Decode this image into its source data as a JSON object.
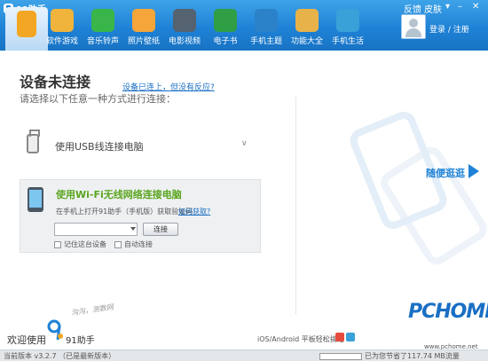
{
  "app": {
    "name": "91助手"
  },
  "window_controls": {
    "feedback": "反馈",
    "skin": "皮肤"
  },
  "nav": {
    "items": [
      {
        "label": "",
        "color": "#f3a623"
      },
      {
        "label": "软件游戏",
        "color": "#f0b43c"
      },
      {
        "label": "音乐铃声",
        "color": "#39b54a"
      },
      {
        "label": "照片壁纸",
        "color": "#f5a53a"
      },
      {
        "label": "电影视频",
        "color": "#556270"
      },
      {
        "label": "电子书",
        "color": "#2f9e44"
      },
      {
        "label": "手机主题",
        "color": "#2b82c9"
      },
      {
        "label": "功能大全",
        "color": "#e8b24a"
      },
      {
        "label": "手机生活",
        "color": "#3aa0d8"
      }
    ]
  },
  "user": {
    "login_label": "登录 / 注册"
  },
  "main": {
    "title": "设备未连接",
    "help_link": "设备已连上，但没有反应?",
    "subtitle": "请选择以下任意一种方式进行连接：",
    "usb": {
      "label": "使用USB线连接电脑",
      "chevron": "»"
    },
    "wifi": {
      "title": "使用Wi-Fi无线网络连接电脑",
      "hint": "在手机上打开91助手（手机版）获取验证码",
      "how_link": "如何获取?",
      "code_value": "",
      "connect_button": "连接",
      "remember_label": "记住这台设备",
      "auto_label": "自动连接"
    },
    "random_link": "随便逛逛"
  },
  "footer": {
    "welcome": "欢迎使用",
    "brand": "91助手",
    "slogan": "沟沟，测数网",
    "platform_text": "iOS/Android 平板轻松搞定"
  },
  "watermark": {
    "logo": "PCHOME",
    "url": "www.pchome.net"
  },
  "status": {
    "version": "当前版本 v3.2.7 （已是最新版本）",
    "saved": "已为您节省了117.74 MB流量",
    "flow_fraction": 0.0
  }
}
